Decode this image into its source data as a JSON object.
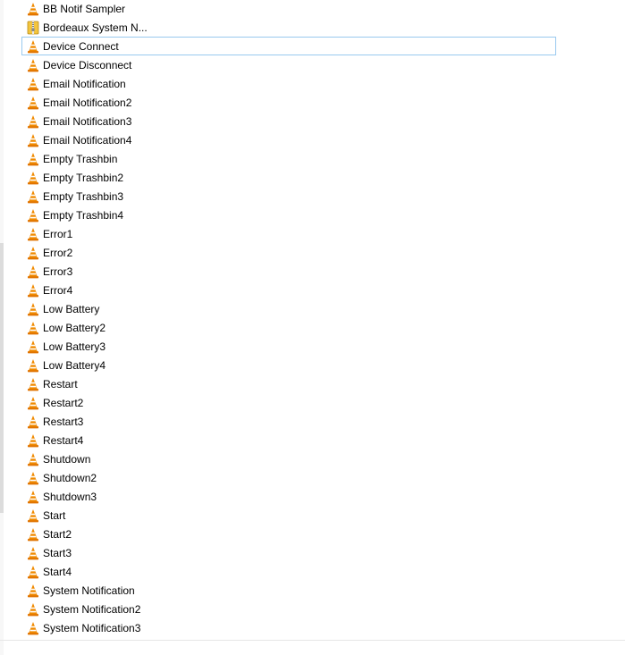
{
  "files": [
    {
      "name": "BB Notif Sampler",
      "icon": "vlc-cone-icon"
    },
    {
      "name": "Bordeaux System N...",
      "icon": "zip-archive-icon"
    },
    {
      "name": "Device Connect",
      "icon": "vlc-cone-icon",
      "focused": true
    },
    {
      "name": "Device Disconnect",
      "icon": "vlc-cone-icon"
    },
    {
      "name": "Email Notification",
      "icon": "vlc-cone-icon"
    },
    {
      "name": "Email Notification2",
      "icon": "vlc-cone-icon"
    },
    {
      "name": "Email Notification3",
      "icon": "vlc-cone-icon"
    },
    {
      "name": "Email Notification4",
      "icon": "vlc-cone-icon"
    },
    {
      "name": "Empty Trashbin",
      "icon": "vlc-cone-icon"
    },
    {
      "name": "Empty Trashbin2",
      "icon": "vlc-cone-icon"
    },
    {
      "name": "Empty Trashbin3",
      "icon": "vlc-cone-icon"
    },
    {
      "name": "Empty Trashbin4",
      "icon": "vlc-cone-icon"
    },
    {
      "name": "Error1",
      "icon": "vlc-cone-icon"
    },
    {
      "name": "Error2",
      "icon": "vlc-cone-icon"
    },
    {
      "name": "Error3",
      "icon": "vlc-cone-icon"
    },
    {
      "name": "Error4",
      "icon": "vlc-cone-icon"
    },
    {
      "name": "Low Battery",
      "icon": "vlc-cone-icon"
    },
    {
      "name": "Low Battery2",
      "icon": "vlc-cone-icon"
    },
    {
      "name": "Low Battery3",
      "icon": "vlc-cone-icon"
    },
    {
      "name": "Low Battery4",
      "icon": "vlc-cone-icon"
    },
    {
      "name": "Restart",
      "icon": "vlc-cone-icon"
    },
    {
      "name": "Restart2",
      "icon": "vlc-cone-icon"
    },
    {
      "name": "Restart3",
      "icon": "vlc-cone-icon"
    },
    {
      "name": "Restart4",
      "icon": "vlc-cone-icon"
    },
    {
      "name": "Shutdown",
      "icon": "vlc-cone-icon"
    },
    {
      "name": "Shutdown2",
      "icon": "vlc-cone-icon"
    },
    {
      "name": "Shutdown3",
      "icon": "vlc-cone-icon"
    },
    {
      "name": "Start",
      "icon": "vlc-cone-icon"
    },
    {
      "name": "Start2",
      "icon": "vlc-cone-icon"
    },
    {
      "name": "Start3",
      "icon": "vlc-cone-icon"
    },
    {
      "name": "Start4",
      "icon": "vlc-cone-icon"
    },
    {
      "name": "System Notification",
      "icon": "vlc-cone-icon"
    },
    {
      "name": "System Notification2",
      "icon": "vlc-cone-icon"
    },
    {
      "name": "System Notification3",
      "icon": "vlc-cone-icon"
    }
  ],
  "colors": {
    "focus_border": "#99c9ef",
    "cone_orange": "#f08a00",
    "cone_stripe": "#ffffff",
    "zip_yellow": "#f3c53e"
  }
}
